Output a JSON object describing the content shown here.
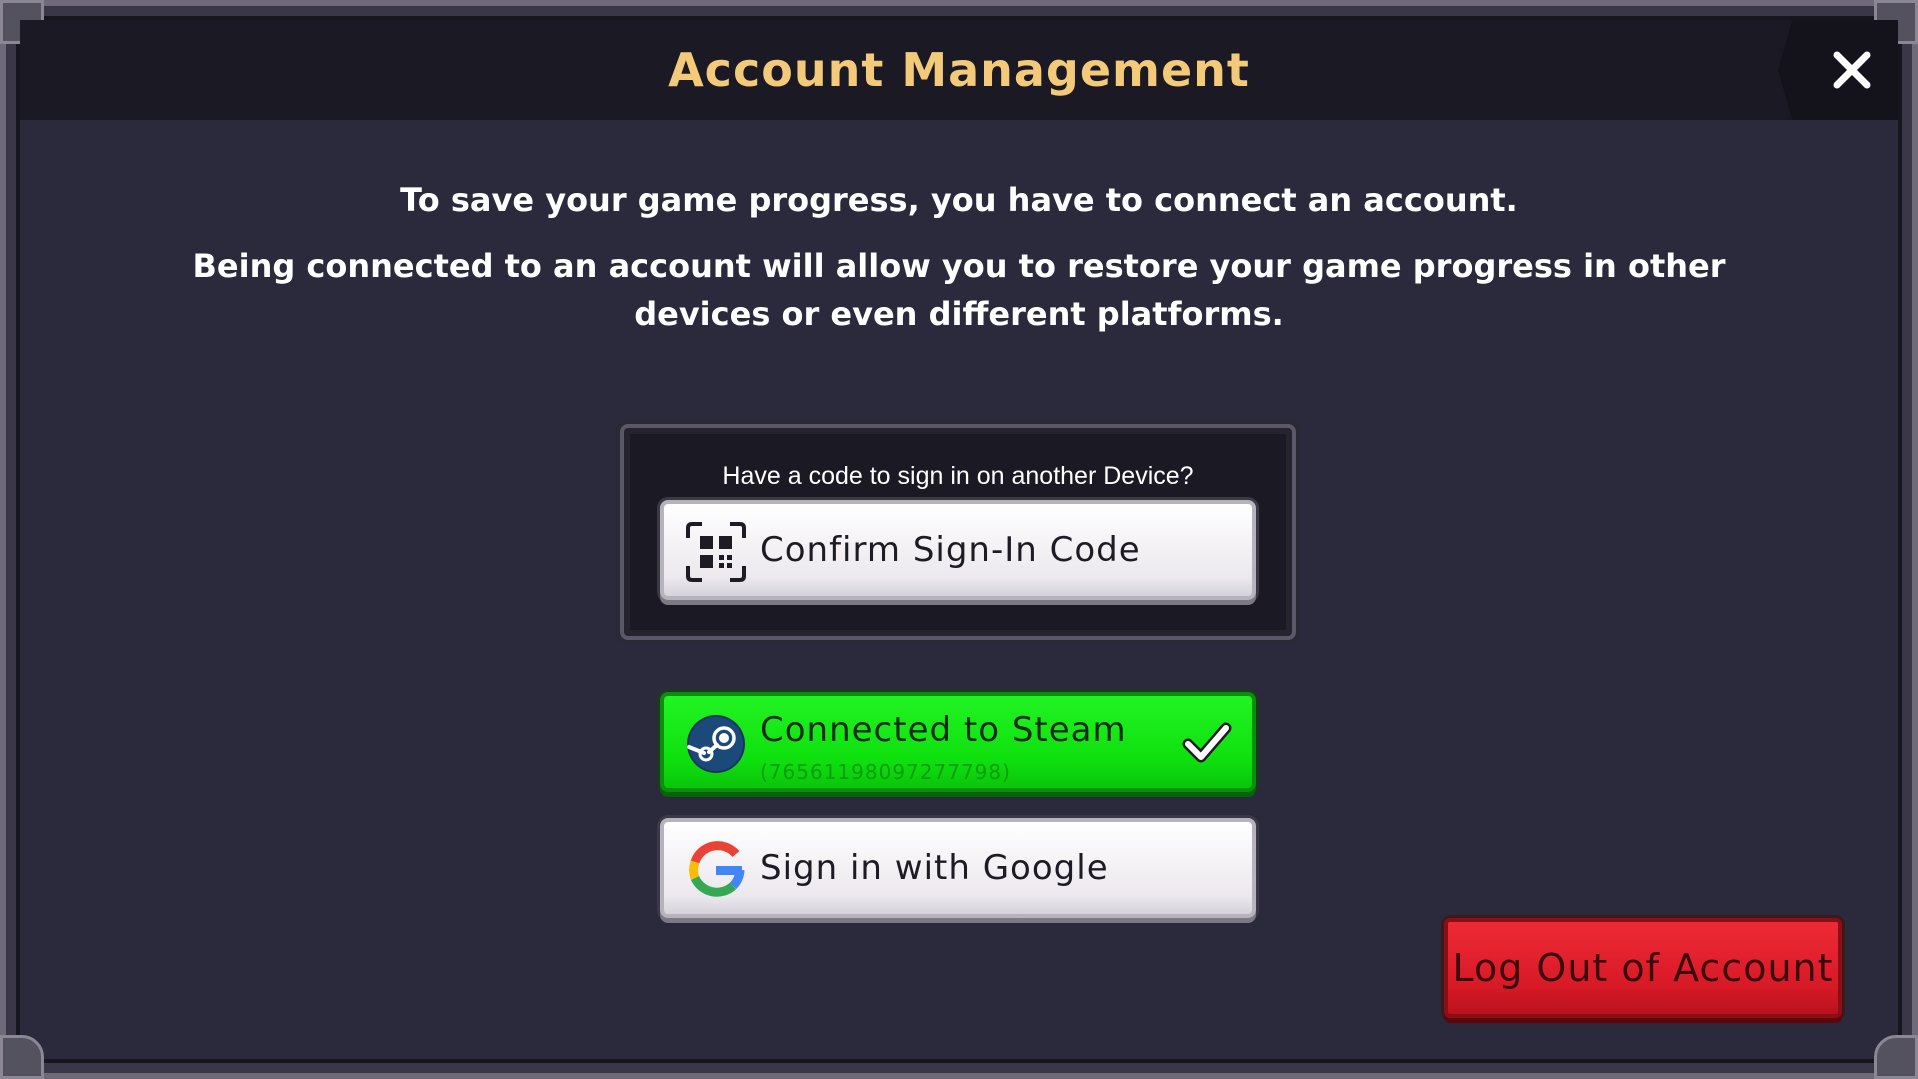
{
  "header": {
    "title": "Account Management",
    "close_icon": "close-icon"
  },
  "description": {
    "line1": "To save your game progress, you have to connect an account.",
    "line2": "Being connected to an account will allow you to restore your game progress in other devices or even different platforms."
  },
  "code_panel": {
    "prompt": "Have a code to sign in on another Device?",
    "confirm_button": {
      "label": "Confirm Sign-In Code",
      "icon": "qr-code-icon"
    }
  },
  "steam": {
    "label": "Connected to Steam",
    "account_id": "(76561198097277798)",
    "icon": "steam-icon",
    "status_icon": "checkmark-icon"
  },
  "google": {
    "label": "Sign in with Google",
    "icon": "google-icon"
  },
  "logout": {
    "label": "Log Out of Account"
  },
  "colors": {
    "title": "#f3c97a",
    "panel_bg": "#2b2a3d",
    "steam_green": "#11e611",
    "logout_red": "#dd1f2b"
  }
}
